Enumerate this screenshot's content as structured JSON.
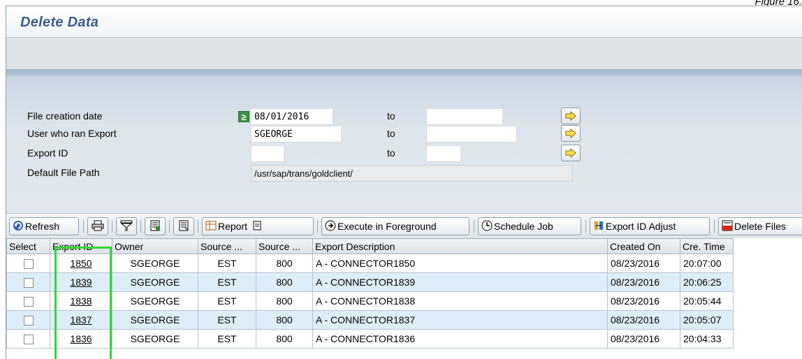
{
  "figure_label": "Figure 16.",
  "window": {
    "title": "Delete Data"
  },
  "selection": {
    "rows": [
      {
        "label": "File creation date",
        "low": "08/01/2016",
        "to_label": "to",
        "high": ""
      },
      {
        "label": "User who ran Export",
        "low": "SGEORGE",
        "to_label": "to",
        "high": ""
      },
      {
        "label": "Export ID",
        "low": "",
        "to_label": "to",
        "high": ""
      },
      {
        "label": "Default File Path",
        "value": "/usr/sap/trans/goldclient/"
      }
    ],
    "option_icon": "≥"
  },
  "toolbar": {
    "refresh": "Refresh",
    "report": "Report",
    "execute_fg": "Execute in Foreground",
    "schedule_job": "Schedule Job",
    "export_adjust": "Export ID Adjust",
    "delete_files": "Delete Files"
  },
  "table": {
    "headers": [
      "Select",
      "Export ID",
      "Owner",
      "Source ...",
      "Source ...",
      "Export Description",
      "Created On",
      "Cre. Time"
    ],
    "rows": [
      {
        "id": "1850",
        "owner": "SGEORGE",
        "src1": "EST",
        "src2": "800",
        "desc": "A - CONNECTOR1850",
        "date": "08/23/2016",
        "time": "20:07:00"
      },
      {
        "id": "1839",
        "owner": "SGEORGE",
        "src1": "EST",
        "src2": "800",
        "desc": "A - CONNECTOR1839",
        "date": "08/23/2016",
        "time": "20:06:25"
      },
      {
        "id": "1838",
        "owner": "SGEORGE",
        "src1": "EST",
        "src2": "800",
        "desc": "A - CONNECTOR1838",
        "date": "08/23/2016",
        "time": "20:05:44"
      },
      {
        "id": "1837",
        "owner": "SGEORGE",
        "src1": "EST",
        "src2": "800",
        "desc": "A - CONNECTOR1837",
        "date": "08/23/2016",
        "time": "20:05:07"
      },
      {
        "id": "1836",
        "owner": "SGEORGE",
        "src1": "EST",
        "src2": "800",
        "desc": "A - CONNECTOR1836",
        "date": "08/23/2016",
        "time": "20:04:33"
      }
    ]
  },
  "colors": {
    "title": "#3e5c86",
    "row_alt": "#ddeef8",
    "highlight": "#33d633"
  }
}
